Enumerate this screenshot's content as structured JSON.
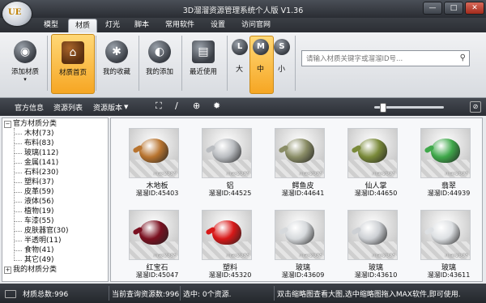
{
  "app": {
    "title": "3D溜溜资源管理系统个人版 V1.36",
    "logo_text": "UE"
  },
  "window_controls": {
    "minimize": "—",
    "maximize": "□",
    "close": "✕"
  },
  "tabs": [
    {
      "label": "模型",
      "active": false
    },
    {
      "label": "材质",
      "active": true
    },
    {
      "label": "灯光",
      "active": false
    },
    {
      "label": "脚本",
      "active": false
    },
    {
      "label": "常用软件",
      "active": false
    },
    {
      "label": "设置",
      "active": false
    },
    {
      "label": "访问官网",
      "active": false
    }
  ],
  "ribbon": {
    "buttons": [
      {
        "label": "添加材质",
        "icon": "rss-icon",
        "glyph": "◉"
      },
      {
        "label": "材质首页",
        "icon": "home-icon",
        "glyph": "⌂"
      },
      {
        "label": "我的收藏",
        "icon": "bluetooth-icon",
        "glyph": "✱"
      },
      {
        "label": "我的添加",
        "icon": "add-icon",
        "glyph": "◐"
      },
      {
        "label": "最近使用",
        "icon": "recent-icon",
        "glyph": "▤"
      }
    ],
    "sizes": [
      {
        "key": "L",
        "label": "大"
      },
      {
        "key": "M",
        "label": "中"
      },
      {
        "key": "S",
        "label": "小"
      }
    ],
    "search": {
      "placeholder": "请输入材质关键字或溜溜ID号...",
      "value": ""
    }
  },
  "toolbar": {
    "official_info": "官方信息",
    "resource_list": "资源列表",
    "resource_version": "资源版本",
    "zoom_level": 0.08
  },
  "tree": {
    "root": "官方材质分类",
    "items": [
      "木材(73)",
      "布料(83)",
      "玻璃(112)",
      "金属(141)",
      "石料(230)",
      "塑料(37)",
      "皮革(59)",
      "液体(56)",
      "植物(19)",
      "车漆(55)",
      "皮肤器官(30)",
      "半透明(11)",
      "食物(41)",
      "其它(49)"
    ],
    "mine": "我的材质分类"
  },
  "materials": [
    {
      "name": "木地板",
      "id": "溜溜ID:45403",
      "color": "#b8742f",
      "watermark": "max2008"
    },
    {
      "name": "铝",
      "id": "溜溜ID:44525",
      "color": "#b9bcc0",
      "watermark": "max2008"
    },
    {
      "name": "鳄鱼皮",
      "id": "溜溜ID:44641",
      "color": "#8a8d66",
      "watermark": "max2008"
    },
    {
      "name": "仙人掌",
      "id": "溜溜ID:44650",
      "color": "#7a8a3a",
      "watermark": "max2008"
    },
    {
      "name": "翡翠",
      "id": "溜溜ID:44939",
      "color": "#3fa84a",
      "watermark": "max2008"
    },
    {
      "name": "红宝石",
      "id": "溜溜ID:45047",
      "color": "#7a1020",
      "watermark": "max2008"
    },
    {
      "name": "塑料",
      "id": "溜溜ID:45320",
      "color": "#d81818",
      "watermark": "max2008"
    },
    {
      "name": "玻璃",
      "id": "溜溜ID:43609",
      "color": "#d6d9dc",
      "watermark": "max2008"
    },
    {
      "name": "玻璃",
      "id": "溜溜ID:43610",
      "color": "#cdd0d4",
      "watermark": "max2008"
    },
    {
      "name": "玻璃",
      "id": "溜溜ID:43611",
      "color": "#dde0e3",
      "watermark": "max2008"
    }
  ],
  "status": {
    "total": "材质总数:996",
    "query": "当前查询资源数:996",
    "selected": "选中: 0个资源.",
    "hint": "双击缩略图查看大图,选中缩略图拖入MAX软件,即可使用."
  }
}
